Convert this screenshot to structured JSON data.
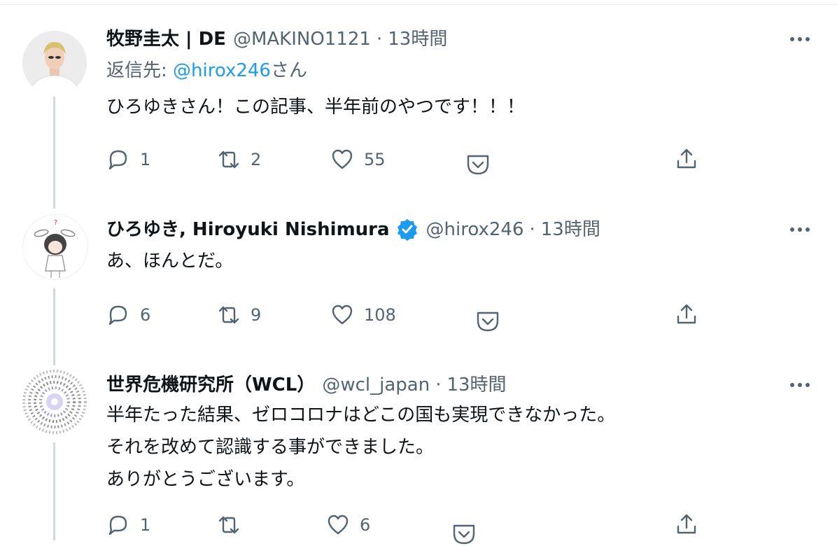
{
  "tweets": [
    {
      "name": "牧野圭太 | DE",
      "handle": "@MAKINO1121",
      "dot": "·",
      "time": "13時間",
      "reply_prefix": "返信先: ",
      "reply_mention": "@hirox246",
      "reply_suffix": "さん",
      "lines": [
        "ひろゆきさん！この記事、半年前のやつです！！！"
      ],
      "replies": "1",
      "retweets": "2",
      "likes": "55"
    },
    {
      "name": "ひろゆき, Hiroyuki Nishimura",
      "verified": true,
      "handle": "@hirox246",
      "dot": "·",
      "time": "13時間",
      "lines": [
        "あ、ほんとだ。"
      ],
      "replies": "6",
      "retweets": "9",
      "likes": "108"
    },
    {
      "name": "世界危機研究所（WCL）",
      "handle": "@wcl_japan",
      "dot": "·",
      "time": "13時間",
      "lines": [
        "半年たった結果、ゼロコロナはどこの国も実現できなかった。",
        "それを改めて認識する事ができました。",
        "ありがとうございます。"
      ],
      "replies": "1",
      "retweets": "",
      "likes": "6"
    }
  ],
  "colors": {
    "text": "#0f1419",
    "muted": "#536471",
    "link": "#1d9bf0",
    "thread_line": "#cfd9de",
    "verified": "#1d9bf0"
  },
  "icons": {
    "reply": "reply-icon",
    "retweet": "retweet-icon",
    "like": "heart-icon",
    "save": "pocket-icon",
    "share": "share-icon",
    "more": "more-icon",
    "verified": "verified-badge-icon"
  }
}
